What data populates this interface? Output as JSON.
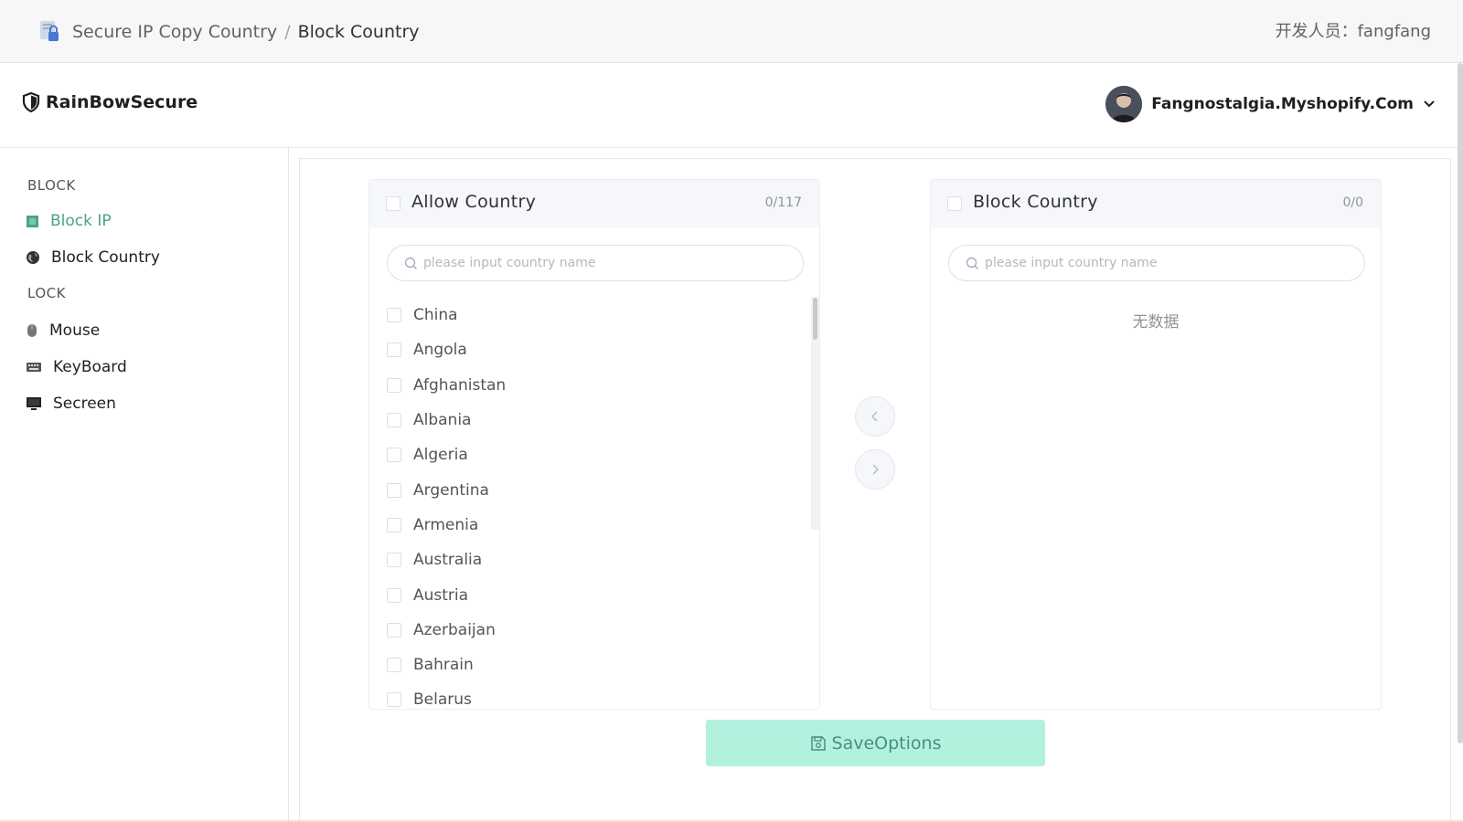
{
  "header": {
    "breadcrumb": {
      "parent": "Secure IP Copy Country",
      "separator": "/",
      "current": "Block Country"
    },
    "developer": "开发人员：fangfang"
  },
  "appbar": {
    "brand": "RainBowSecure",
    "account": "Fangnostalgia.Myshopify.Com"
  },
  "sidebar": {
    "sections": [
      {
        "title": "BLOCK"
      },
      {
        "title": "LOCK"
      }
    ],
    "items": [
      {
        "label": "Block IP",
        "icon": "block-ip-icon",
        "active": true
      },
      {
        "label": "Block Country",
        "icon": "globe-icon",
        "active": false
      },
      {
        "label": "Mouse",
        "icon": "mouse-icon",
        "active": false
      },
      {
        "label": "KeyBoard",
        "icon": "keyboard-icon",
        "active": false
      },
      {
        "label": "Secreen",
        "icon": "monitor-icon",
        "active": false
      }
    ]
  },
  "transfer": {
    "left": {
      "title": "Allow Country",
      "count": "0/117",
      "search_placeholder": "please input country name",
      "items": [
        "China",
        "Angola",
        "Afghanistan",
        "Albania",
        "Algeria",
        "Argentina",
        "Armenia",
        "Australia",
        "Austria",
        "Azerbaijan",
        "Bahrain",
        "Belarus"
      ]
    },
    "right": {
      "title": "Block Country",
      "count": "0/0",
      "search_placeholder": "please input country name",
      "empty_text": "无数据"
    }
  },
  "save_button": {
    "label": "SaveOptions"
  },
  "colors": {
    "accent": "#4aa38a",
    "save_bg": "#b3f1df"
  }
}
